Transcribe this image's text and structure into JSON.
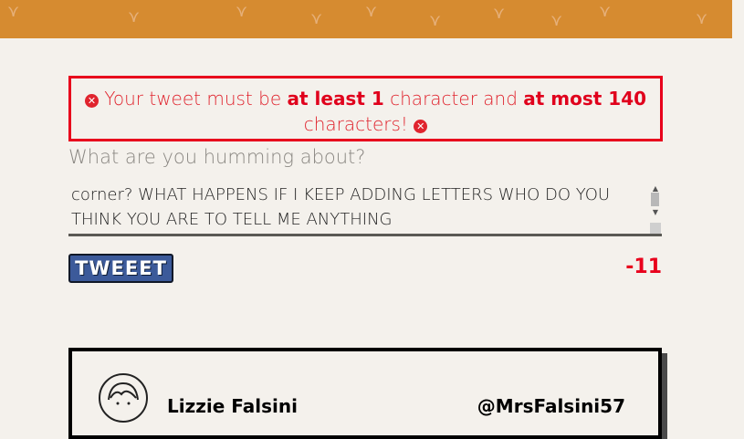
{
  "banner": {
    "color": "#d68b30",
    "pattern_icon": "bird-icon"
  },
  "error": {
    "part1": "Your tweet must be ",
    "bold1": "at least 1",
    "part2": " character and ",
    "bold2": "at most 140",
    "part3": "characters!",
    "icon": "close-circle-icon",
    "color": "#e8001c"
  },
  "compose": {
    "prompt": "What are you humming about?",
    "text": "corner? WHAT HAPPENS IF I KEEP ADDING LETTERS WHO DO YOU THINK YOU ARE TO TELL ME ANYTHING",
    "button_label": "TWEEET",
    "counter": "-11"
  },
  "card": {
    "avatar_icon": "user-avatar-icon",
    "name": "Lizzie Falsini",
    "handle": "@MrsFalsini57"
  }
}
